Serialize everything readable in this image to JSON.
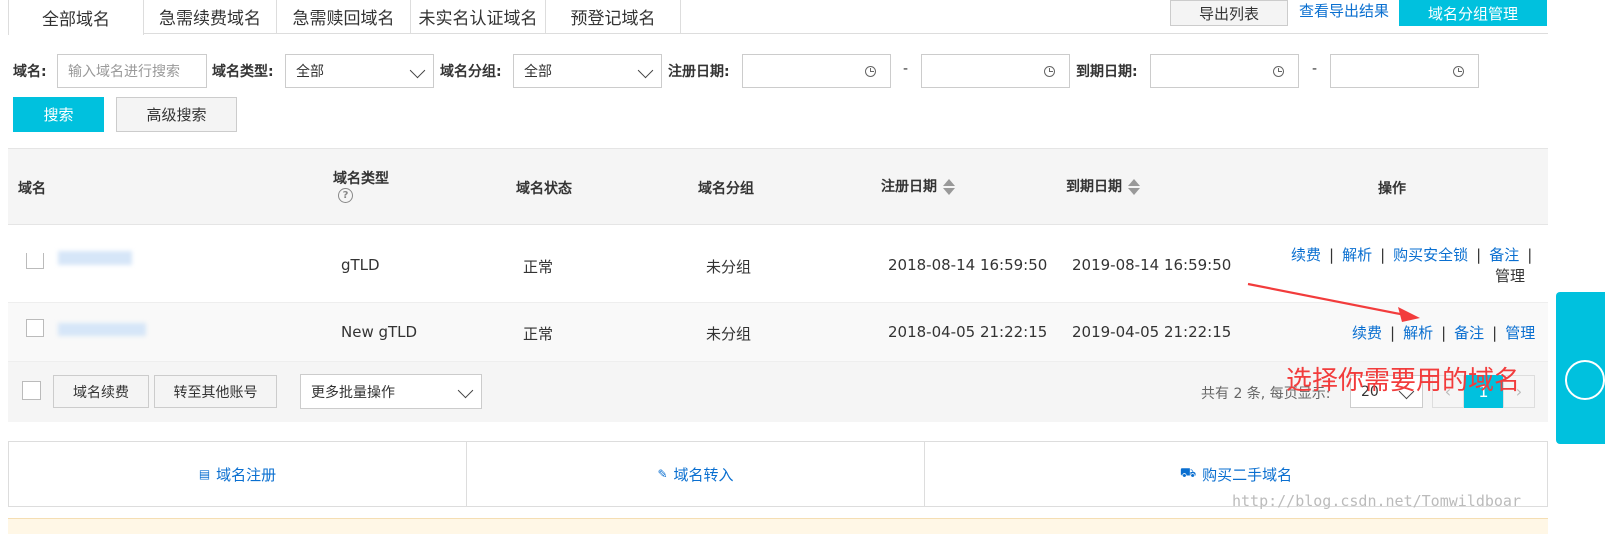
{
  "tabs": [
    "全部域名",
    "急需续费域名",
    "急需赎回域名",
    "未实名认证域名",
    "预登记域名"
  ],
  "header_actions": {
    "export_list": "导出列表",
    "view_export": "查看导出结果",
    "group_manage": "域名分组管理"
  },
  "filters": {
    "domain_label": "域名:",
    "domain_placeholder": "输入域名进行搜索",
    "type_label": "域名类型:",
    "type_value": "全部",
    "group_label": "域名分组:",
    "group_value": "全部",
    "reg_label": "注册日期:",
    "dash": "-",
    "exp_label": "到期日期:"
  },
  "buttons": {
    "search": "搜索",
    "advanced": "高级搜索"
  },
  "table": {
    "headers": {
      "domain": "域名",
      "type": "域名类型",
      "status": "域名状态",
      "group": "域名分组",
      "reg": "注册日期",
      "exp": "到期日期",
      "ops": "操作"
    },
    "help_icon": "?",
    "rows": [
      {
        "type": "gTLD",
        "status": "正常",
        "group": "未分组",
        "reg": "2018-08-14 16:59:50",
        "exp": "2019-08-14 16:59:50",
        "ops": [
          "续费",
          "解析",
          "购买安全锁",
          "备注",
          "管理"
        ]
      },
      {
        "type": "New gTLD",
        "status": "正常",
        "group": "未分组",
        "reg": "2018-04-05 21:22:15",
        "exp": "2019-04-05 21:22:15",
        "ops": [
          "续费",
          "解析",
          "备注",
          "管理"
        ]
      }
    ],
    "separator": "|"
  },
  "bulk": {
    "renew": "域名续费",
    "transfer": "转至其他账号",
    "more": "更多批量操作"
  },
  "pagination": {
    "summary": "共有 2 条, 每页显示:",
    "page_size": "20",
    "current_page": "1",
    "prev": "‹",
    "next": "›"
  },
  "annotation": {
    "text": "选择你需要用的域名",
    "color": "#f23c3c"
  },
  "footer": {
    "register": "域名注册",
    "transfer_in": "域名转入",
    "buy_second": "购买二手域名"
  },
  "watermark": "http://blog.csdn.net/Tomwildboar",
  "colors": {
    "accent": "#00c1de",
    "link": "#0a6fd0"
  }
}
